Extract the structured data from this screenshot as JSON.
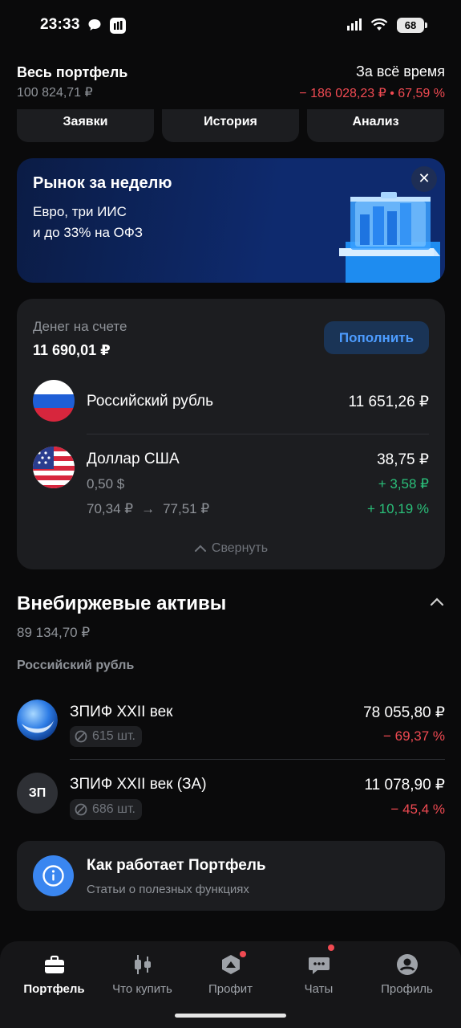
{
  "status_bar": {
    "time": "23:33",
    "battery": "68"
  },
  "header": {
    "title": "Весь портфель",
    "value": "100 824,71 ₽",
    "period": "За всё время",
    "change": "− 186 028,23 ₽ • 67,59 %"
  },
  "tabs": [
    "Заявки",
    "История",
    "Анализ"
  ],
  "promo": {
    "title": "Рынок за неделю",
    "line1": "Евро, три ИИС",
    "line2": "и до 33% на ОФЗ"
  },
  "cash": {
    "label": "Денег на счете",
    "total": "11 690,01 ₽",
    "topup": "Пополнить",
    "currencies": [
      {
        "name": "Российский рубль",
        "amount": "11 651,26 ₽"
      },
      {
        "name": "Доллар США",
        "amount": "38,75 ₽",
        "quantity": "0,50 $",
        "rate_from": "70,34 ₽",
        "arrow": "→",
        "rate_to": "77,51 ₽",
        "change_abs": "+ 3,58 ₽",
        "change_pct": "+ 10,19 %"
      }
    ],
    "collapse": "Свернуть"
  },
  "otc": {
    "title": "Внебиржевые активы",
    "value": "89 134,70 ₽",
    "section": "Российский рубль",
    "assets": [
      {
        "name": "ЗПИФ XXII век",
        "amount": "78 055,80 ₽",
        "change": "− 69,37 %",
        "qty": "615 шт."
      },
      {
        "name": "ЗПИФ XXII век (ЗА)",
        "initials": "ЗП",
        "amount": "11 078,90 ₽",
        "change": "− 45,4 %",
        "qty": "686 шт."
      }
    ]
  },
  "info": {
    "title": "Как работает Портфель",
    "subtitle": "Статьи о полезных функциях"
  },
  "nav": [
    {
      "label": "Портфель",
      "icon": "briefcase-icon"
    },
    {
      "label": "Что купить",
      "icon": "candles-icon"
    },
    {
      "label": "Профит",
      "icon": "profit-icon"
    },
    {
      "label": "Чаты",
      "icon": "chat-icon"
    },
    {
      "label": "Профиль",
      "icon": "profile-icon"
    }
  ],
  "colors": {
    "accent": "#4d9cff",
    "negative": "#f04a52",
    "positive": "#2ac07a",
    "background": "#0a0a0b",
    "card": "#1c1d20"
  }
}
